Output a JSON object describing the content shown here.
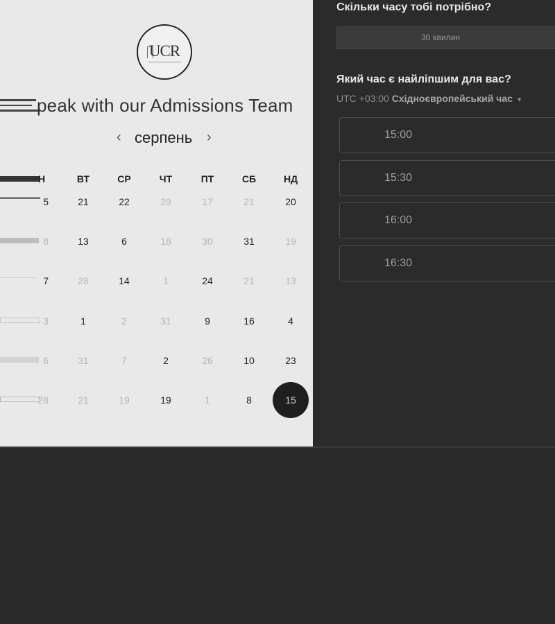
{
  "left": {
    "logo_text": "UCR",
    "title": "peak with our Admissions Team",
    "month": "серпень",
    "prev_symbol": "‹",
    "next_symbol": "›",
    "day_headers": [
      "Н",
      "ВТ",
      "СР",
      "ЧТ",
      "ПТ",
      "СБ",
      "НД"
    ],
    "weeks": [
      [
        "5",
        "21",
        "22",
        "29",
        "17",
        "21",
        "20"
      ],
      [
        "8",
        "13",
        "6",
        "18",
        "30",
        "31",
        "19"
      ],
      [
        "7",
        "28",
        "14",
        "1",
        "24",
        "21",
        "13"
      ],
      [
        "3",
        "1",
        "2",
        "31",
        "9",
        "16",
        "4"
      ],
      [
        "6",
        "31",
        "7",
        "2",
        "26",
        "10",
        "23"
      ],
      [
        "28",
        "21",
        "19",
        "19",
        "1",
        "8",
        "15"
      ]
    ]
  },
  "right": {
    "duration_question": "Скільки часу тобі потрібно?",
    "duration_value": "30 хвилин",
    "time_question": "Який час є найліпшим для вас?",
    "timezone_offset": "UTC +03:00",
    "timezone_name": "Східноєвропейський час",
    "timezone_caret": "▾",
    "slots": [
      "15:00",
      "15:30",
      "16:00",
      "16:30"
    ]
  },
  "colors": {
    "left_bg": "#e9e9e9",
    "right_bg": "#2b2b2b",
    "selected_day": "#1f1f1f"
  }
}
